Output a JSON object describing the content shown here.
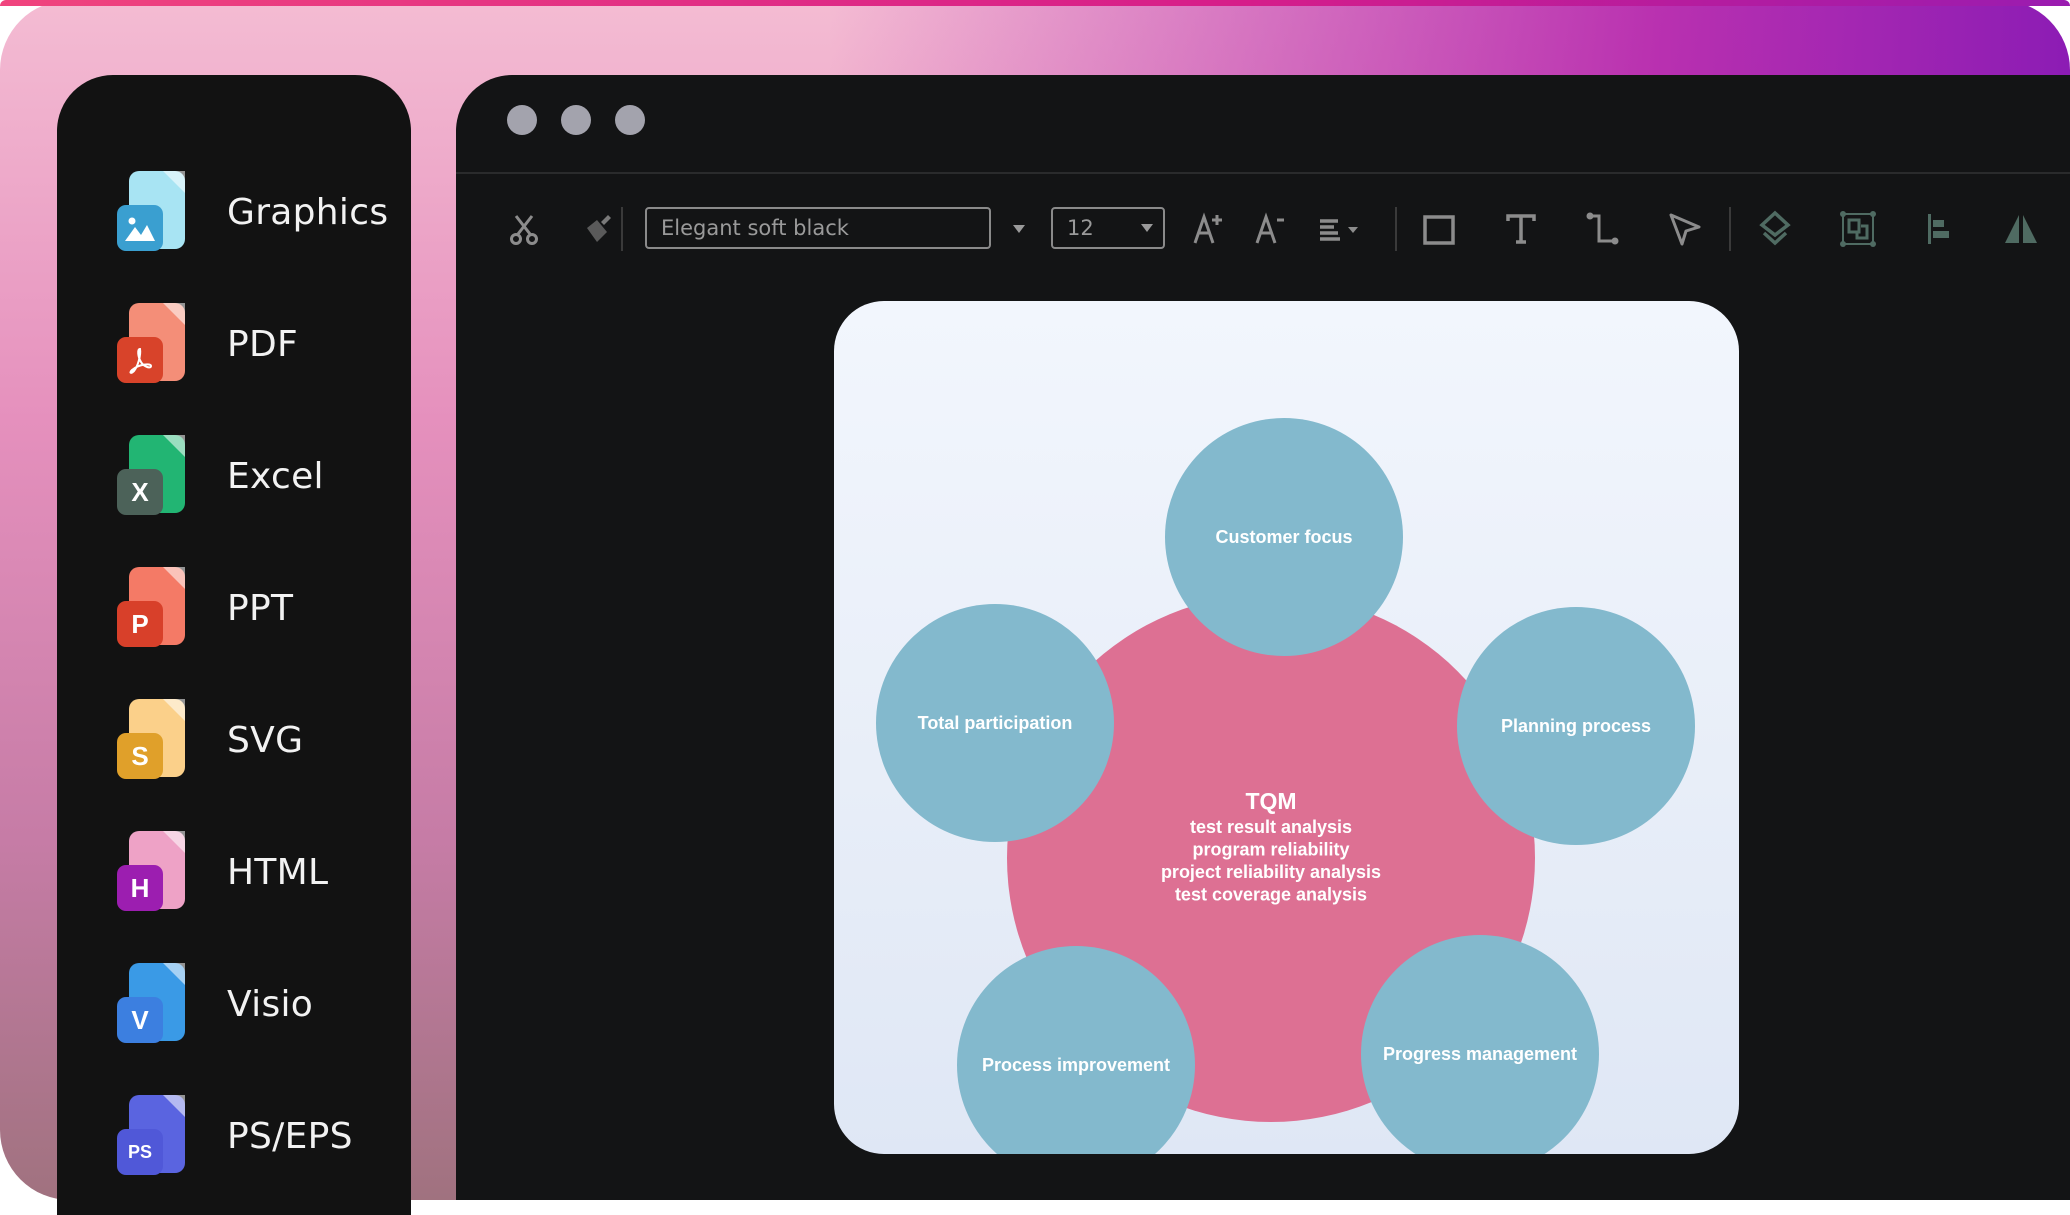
{
  "sidebar": {
    "items": [
      {
        "label": "Graphics",
        "icon": "image-file-icon",
        "badge": "",
        "sheet": "#a8e4f3",
        "badge_color": "#3a9fd0"
      },
      {
        "label": "PDF",
        "icon": "pdf-file-icon",
        "badge": "",
        "sheet": "#f48e78",
        "badge_color": "#d8432a"
      },
      {
        "label": "Excel",
        "icon": "excel-file-icon",
        "badge": "X",
        "sheet": "#22b573",
        "badge_color": "#4c6259"
      },
      {
        "label": "PPT",
        "icon": "ppt-file-icon",
        "badge": "P",
        "sheet": "#f47a66",
        "badge_color": "#d8402a"
      },
      {
        "label": "SVG",
        "icon": "svg-file-icon",
        "badge": "S",
        "sheet": "#fbd08a",
        "badge_color": "#e0a02a"
      },
      {
        "label": "HTML",
        "icon": "html-file-icon",
        "badge": "H",
        "sheet": "#eea2c6",
        "badge_color": "#9c1eb0"
      },
      {
        "label": "Visio",
        "icon": "visio-file-icon",
        "badge": "V",
        "sheet": "#3a9ae6",
        "badge_color": "#3c7fe0"
      },
      {
        "label": "PS/EPS",
        "icon": "ps-eps-file-icon",
        "badge": "PS",
        "sheet": "#5a64e0",
        "badge_color": "#5058d8"
      }
    ]
  },
  "toolbar": {
    "font_name": "Elegant soft black",
    "font_size": "12",
    "tools": [
      "cut-icon",
      "format-painter-icon",
      "increase-font-icon",
      "decrease-font-icon",
      "align-icon",
      "rectangle-icon",
      "text-icon",
      "connector-icon",
      "pointer-icon",
      "layers-icon",
      "group-icon",
      "align-left-icon",
      "flip-icon"
    ]
  },
  "diagram": {
    "center": {
      "title": "TQM",
      "lines": [
        "test result analysis",
        "program reliability",
        "project reliability analysis",
        "test coverage analysis"
      ],
      "color": "#dd7093"
    },
    "nodes": [
      {
        "label": "Customer focus"
      },
      {
        "label": "Total participation"
      },
      {
        "label": "Planning process"
      },
      {
        "label": "Process improvement"
      },
      {
        "label": "Progress management"
      }
    ],
    "node_color": "#83b9cd"
  }
}
